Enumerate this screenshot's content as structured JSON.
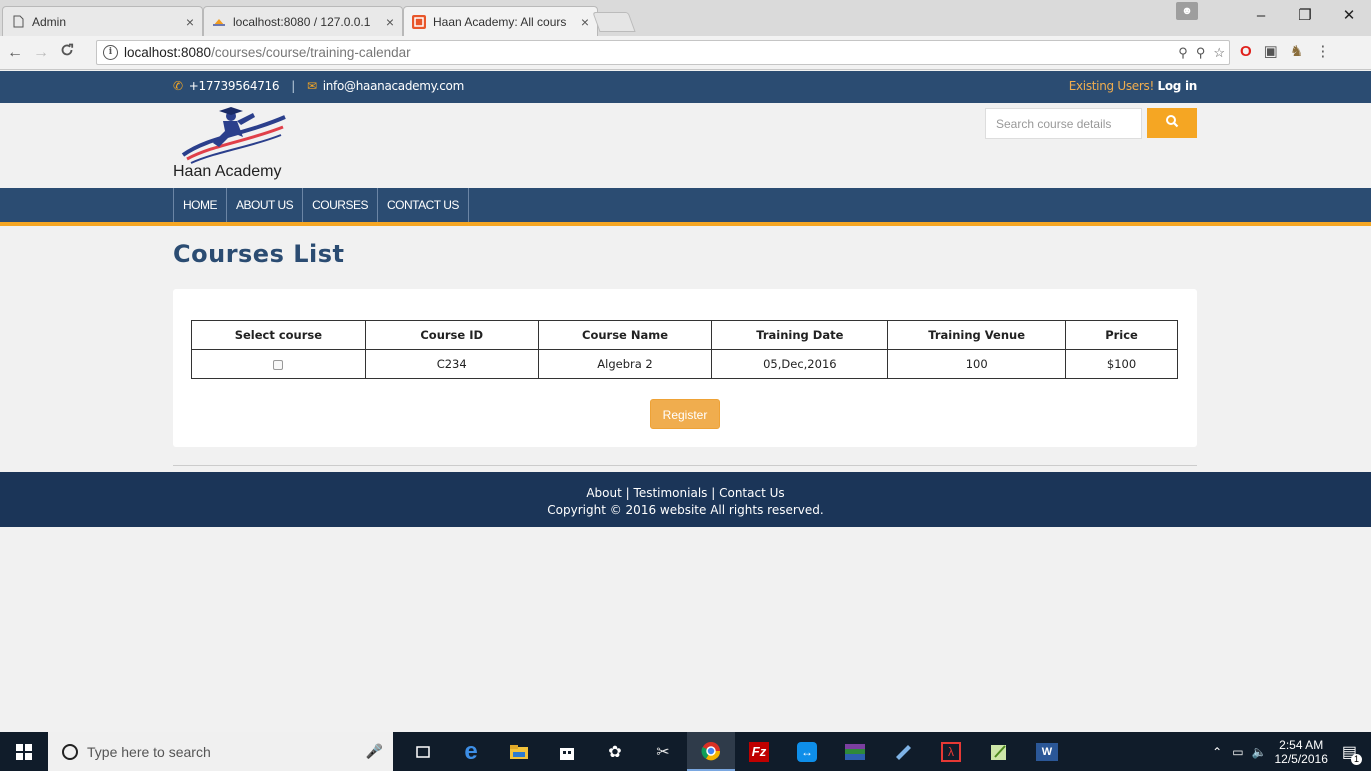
{
  "browser": {
    "tabs": [
      {
        "title": "Admin",
        "close": "×"
      },
      {
        "title": "localhost:8080 / 127.0.0.1",
        "close": "×"
      },
      {
        "title": "Haan Academy: All cours",
        "close": "×"
      }
    ],
    "window_controls": {
      "minimize": "–",
      "restore": "❐",
      "close": "✕"
    },
    "url_host": "localhost:8080",
    "url_path": "/courses/course/training-calendar"
  },
  "site": {
    "phone": "+17739564716",
    "email": "info@haanacademy.com",
    "existing_users": "Existing Users!",
    "login_label": "Log in",
    "logo_text": "Haan Academy",
    "search_placeholder": "Search course details",
    "nav": [
      "HOME",
      "ABOUT US",
      "COURSES",
      "CONTACT US"
    ],
    "colors": {
      "primary": "#2b4c72",
      "accent": "#f5a623",
      "footer": "#1b3558"
    }
  },
  "main": {
    "title": "Courses List",
    "table": {
      "headers": [
        "Select course",
        "Course ID",
        "Course Name",
        "Training Date",
        "Training Venue",
        "Price"
      ],
      "rows": [
        {
          "course_id": "C234",
          "course_name": "Algebra 2",
          "training_date": "05,Dec,2016",
          "training_venue": "100",
          "price": "$100"
        }
      ]
    },
    "register_label": "Register"
  },
  "footer": {
    "links": [
      "About",
      "Testimonials",
      "Contact Us"
    ],
    "separator": "|",
    "copyright": "Copyright © 2016 website All rights reserved."
  },
  "taskbar": {
    "search_placeholder": "Type here to search",
    "time": "2:54 AM",
    "date": "12/5/2016",
    "notification_count": "1"
  }
}
